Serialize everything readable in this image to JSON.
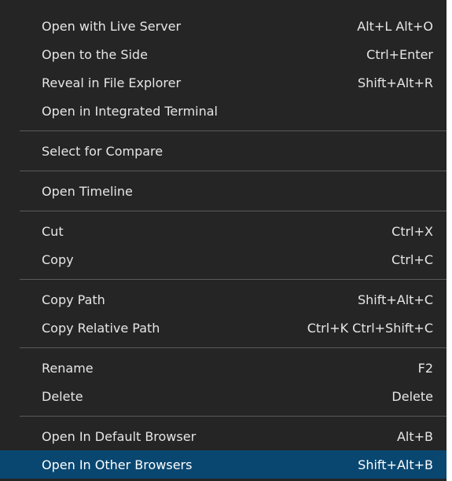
{
  "menu": {
    "groups": [
      {
        "items": [
          {
            "label": "Open with Live Server",
            "shortcut": "Alt+L Alt+O"
          },
          {
            "label": "Open to the Side",
            "shortcut": "Ctrl+Enter"
          },
          {
            "label": "Reveal in File Explorer",
            "shortcut": "Shift+Alt+R"
          },
          {
            "label": "Open in Integrated Terminal",
            "shortcut": ""
          }
        ]
      },
      {
        "items": [
          {
            "label": "Select for Compare",
            "shortcut": ""
          }
        ]
      },
      {
        "items": [
          {
            "label": "Open Timeline",
            "shortcut": ""
          }
        ]
      },
      {
        "items": [
          {
            "label": "Cut",
            "shortcut": "Ctrl+X"
          },
          {
            "label": "Copy",
            "shortcut": "Ctrl+C"
          }
        ]
      },
      {
        "items": [
          {
            "label": "Copy Path",
            "shortcut": "Shift+Alt+C"
          },
          {
            "label": "Copy Relative Path",
            "shortcut": "Ctrl+K Ctrl+Shift+C"
          }
        ]
      },
      {
        "items": [
          {
            "label": "Rename",
            "shortcut": "F2"
          },
          {
            "label": "Delete",
            "shortcut": "Delete"
          }
        ]
      },
      {
        "items": [
          {
            "label": "Open In Default Browser",
            "shortcut": "Alt+B"
          },
          {
            "label": "Open In Other Browsers",
            "shortcut": "Shift+Alt+B",
            "selected": true
          }
        ]
      }
    ]
  },
  "colors": {
    "background": "#252526",
    "text": "#e6e6e6",
    "selected_background": "#094771",
    "separator": "#5a5a5a"
  }
}
